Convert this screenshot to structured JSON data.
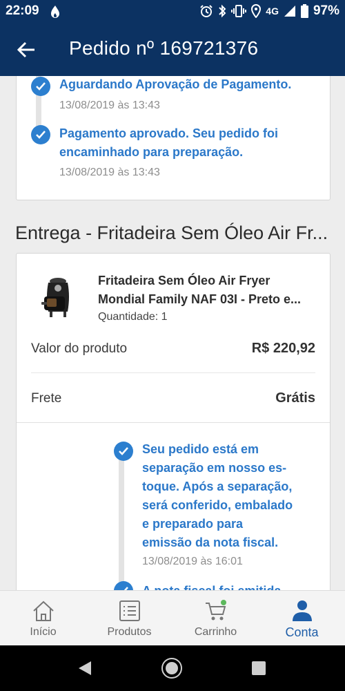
{
  "status_bar": {
    "time": "22:09",
    "network": "4G",
    "battery": "97%"
  },
  "header": {
    "title": "Pedido nº 169721376"
  },
  "timeline_top": [
    {
      "title_lines": [
        "Aguardando Aprovação de Pagamento."
      ],
      "date": "13/08/2019 às 13:43"
    },
    {
      "title_lines": [
        "Pagamento aprovado. Seu pedido foi",
        "encaminhado para preparação."
      ],
      "date": "13/08/2019 às 13:43"
    }
  ],
  "delivery": {
    "section_title": "Entrega - Fritadeira Sem Óleo Air Fr...",
    "product": {
      "name_line1": "Fritadeira Sem Óleo Air Fryer",
      "name_line2": "Mondial Family NAF 03I - Preto e...",
      "quantity": "Quantidade: 1"
    },
    "price_label": "Valor do produto",
    "price_value": "R$ 220,92",
    "shipping_label": "Frete",
    "shipping_value": "Grátis"
  },
  "timeline_bottom": [
    {
      "title_lines": [
        "Seu pedido está em",
        "separação em nosso es-",
        "toque. Após a separação,",
        "será conferido, embalado",
        "e preparado para",
        "emissão da nota fiscal."
      ],
      "date": "13/08/2019 às 16:01"
    },
    {
      "title_lines": [
        "A nota fiscal foi emitida"
      ]
    }
  ],
  "bottom_nav": [
    {
      "label": "Início",
      "icon": "home-icon",
      "active": false
    },
    {
      "label": "Produtos",
      "icon": "list-icon",
      "active": false
    },
    {
      "label": "Carrinho",
      "icon": "cart-icon",
      "active": false
    },
    {
      "label": "Conta",
      "icon": "user-icon",
      "active": true
    }
  ],
  "colors": {
    "header_bg": "#0c3262",
    "accent": "#2b78c9",
    "active_nav": "#1f5ea8"
  }
}
